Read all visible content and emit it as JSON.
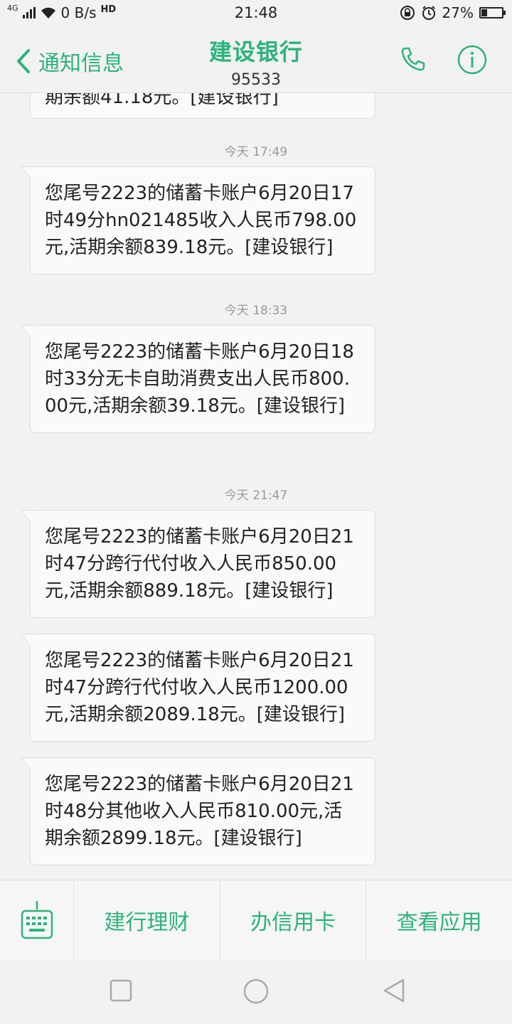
{
  "status_bar": {
    "network": "4G",
    "speed": "0 B/s",
    "hd": "HD",
    "time": "21:48",
    "battery": "27%",
    "battery_level": 0.27
  },
  "header": {
    "back_label": "通知信息",
    "title": "建设银行",
    "subtitle": "95533"
  },
  "messages": {
    "partial_top": "期余额41.18元。[建设银行]",
    "ts1": "今天 17:49",
    "msg1": "您尾号2223的储蓄卡账户6月20日17时49分hn021485收入人民币798.00元,活期余额839.18元。[建设银行]",
    "ts2": "今天 18:33",
    "msg2": "您尾号2223的储蓄卡账户6月20日18时33分无卡自助消费支出人民币800.00元,活期余额39.18元。[建设银行]",
    "ts3": "今天 21:47",
    "msg3": "您尾号2223的储蓄卡账户6月20日21时47分跨行代付收入人民币850.00元,活期余额889.18元。[建设银行]",
    "msg4": "您尾号2223的储蓄卡账户6月20日21时47分跨行代付收入人民币1200.00元,活期余额2089.18元。[建设银行]",
    "msg5": "您尾号2223的储蓄卡账户6月20日21时48分其他收入人民币810.00元,活期余额2899.18元。[建设银行]"
  },
  "bottom_menu": {
    "item1": "建行理财",
    "item2": "办信用卡",
    "item3": "查看应用"
  },
  "colors": {
    "accent": "#2db37a",
    "bubble_bg": "#fafafa",
    "page_bg": "#f2f2f2"
  }
}
